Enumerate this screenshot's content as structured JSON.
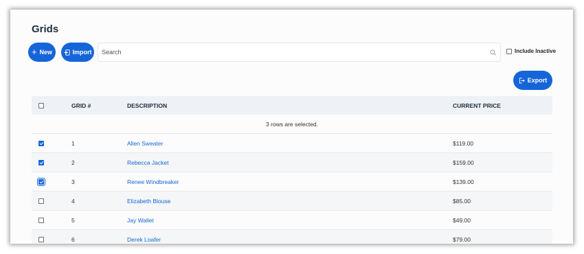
{
  "page": {
    "title": "Grids"
  },
  "toolbar": {
    "new_label": "New",
    "import_label": "Import",
    "export_label": "Export",
    "search_placeholder": "Search",
    "include_inactive_label": "Include Inactive",
    "include_inactive_checked": false
  },
  "table": {
    "headers": {
      "number": "GRID #",
      "description": "DESCRIPTION",
      "price": "CURRENT PRICE"
    },
    "selection_message": "3 rows are selected.",
    "rows": [
      {
        "number": "1",
        "description": "Allen Sweater",
        "price": "$119.00",
        "selected": true
      },
      {
        "number": "2",
        "description": "Rebecca Jacket",
        "price": "$159.00",
        "selected": true
      },
      {
        "number": "3",
        "description": "Renee Windbreaker",
        "price": "$139.00",
        "selected": true
      },
      {
        "number": "4",
        "description": "Elizabeth Blouse",
        "price": "$85.00",
        "selected": false
      },
      {
        "number": "5",
        "description": "Jay Wallet",
        "price": "$49.00",
        "selected": false
      },
      {
        "number": "6",
        "description": "Derek Loafer",
        "price": "$79.00",
        "selected": false
      }
    ]
  },
  "colors": {
    "accent": "#1565d8",
    "header_bg": "#eef1f5",
    "title": "#1f2e3d"
  },
  "icons": {
    "new": "plus-icon",
    "import": "import-icon",
    "export": "export-icon",
    "search": "search-icon"
  }
}
